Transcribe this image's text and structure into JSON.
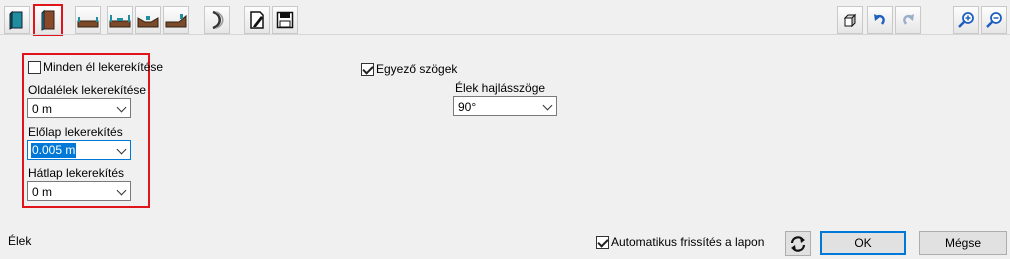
{
  "toolbar": {
    "left_icons": [
      "book-color-icon",
      "book-edge-selected-icon",
      "edge-flat-icon",
      "edge-groove-icon",
      "edge-rabbet-icon",
      "edge-bevel-icon",
      "curve-icon",
      "edit-document-icon",
      "save-icon"
    ],
    "right_icons": [
      "3d-box-icon",
      "undo-icon",
      "redo-icon",
      "zoom-in-icon",
      "zoom-out-icon"
    ]
  },
  "left_panel": {
    "round_all_edges_label": "Minden él lekerekítése",
    "round_all_edges_checked": false,
    "side_edges_label": "Oldalélek lekerekítése",
    "side_edges_value": "0 m",
    "front_face_label": "Előlap lekerekítés",
    "front_face_value": "0.005 m",
    "back_face_label": "Hátlap lekerekítés",
    "back_face_value": "0 m"
  },
  "middle_panel": {
    "equal_angles_label": "Egyező szögek",
    "equal_angles_checked": true,
    "edge_angle_label": "Élek hajlásszöge",
    "edge_angle_value": "90°"
  },
  "footer": {
    "section_label": "Élek",
    "auto_refresh_label": "Automatikus frissítés a lapon",
    "auto_refresh_checked": true,
    "ok_label": "OK",
    "cancel_label": "Mégse"
  },
  "colors": {
    "highlight_border": "#e0151b",
    "accent": "#0078d7"
  }
}
